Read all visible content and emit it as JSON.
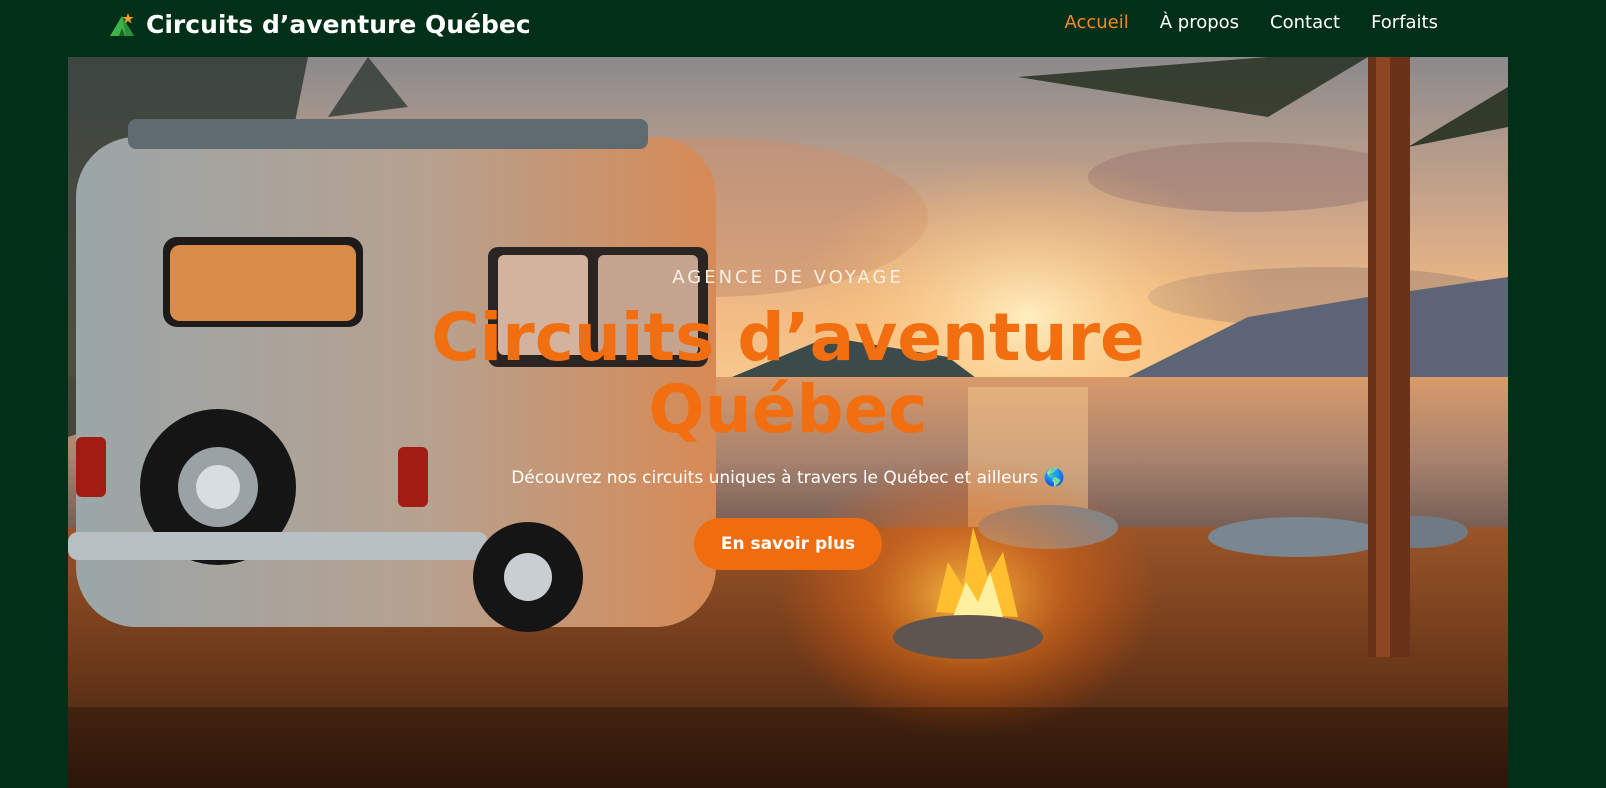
{
  "header": {
    "brand": {
      "icon": "tent-icon",
      "name": "Circuits d’aventure Québec"
    },
    "nav": [
      {
        "label": "Accueil",
        "active": true
      },
      {
        "label": "À propos",
        "active": false
      },
      {
        "label": "Contact",
        "active": false
      },
      {
        "label": "Forfaits",
        "active": false
      }
    ]
  },
  "hero": {
    "kicker": "AGENCE DE VOYAGE",
    "title": "Circuits d’aventure Québec",
    "subtitle": "Découvrez nos circuits uniques à travers le Québec et ailleurs 🌎",
    "cta_label": "En savoir plus"
  },
  "colors": {
    "background": "#022f17",
    "accent": "#f06c0e",
    "nav_active": "#f28a2a"
  }
}
